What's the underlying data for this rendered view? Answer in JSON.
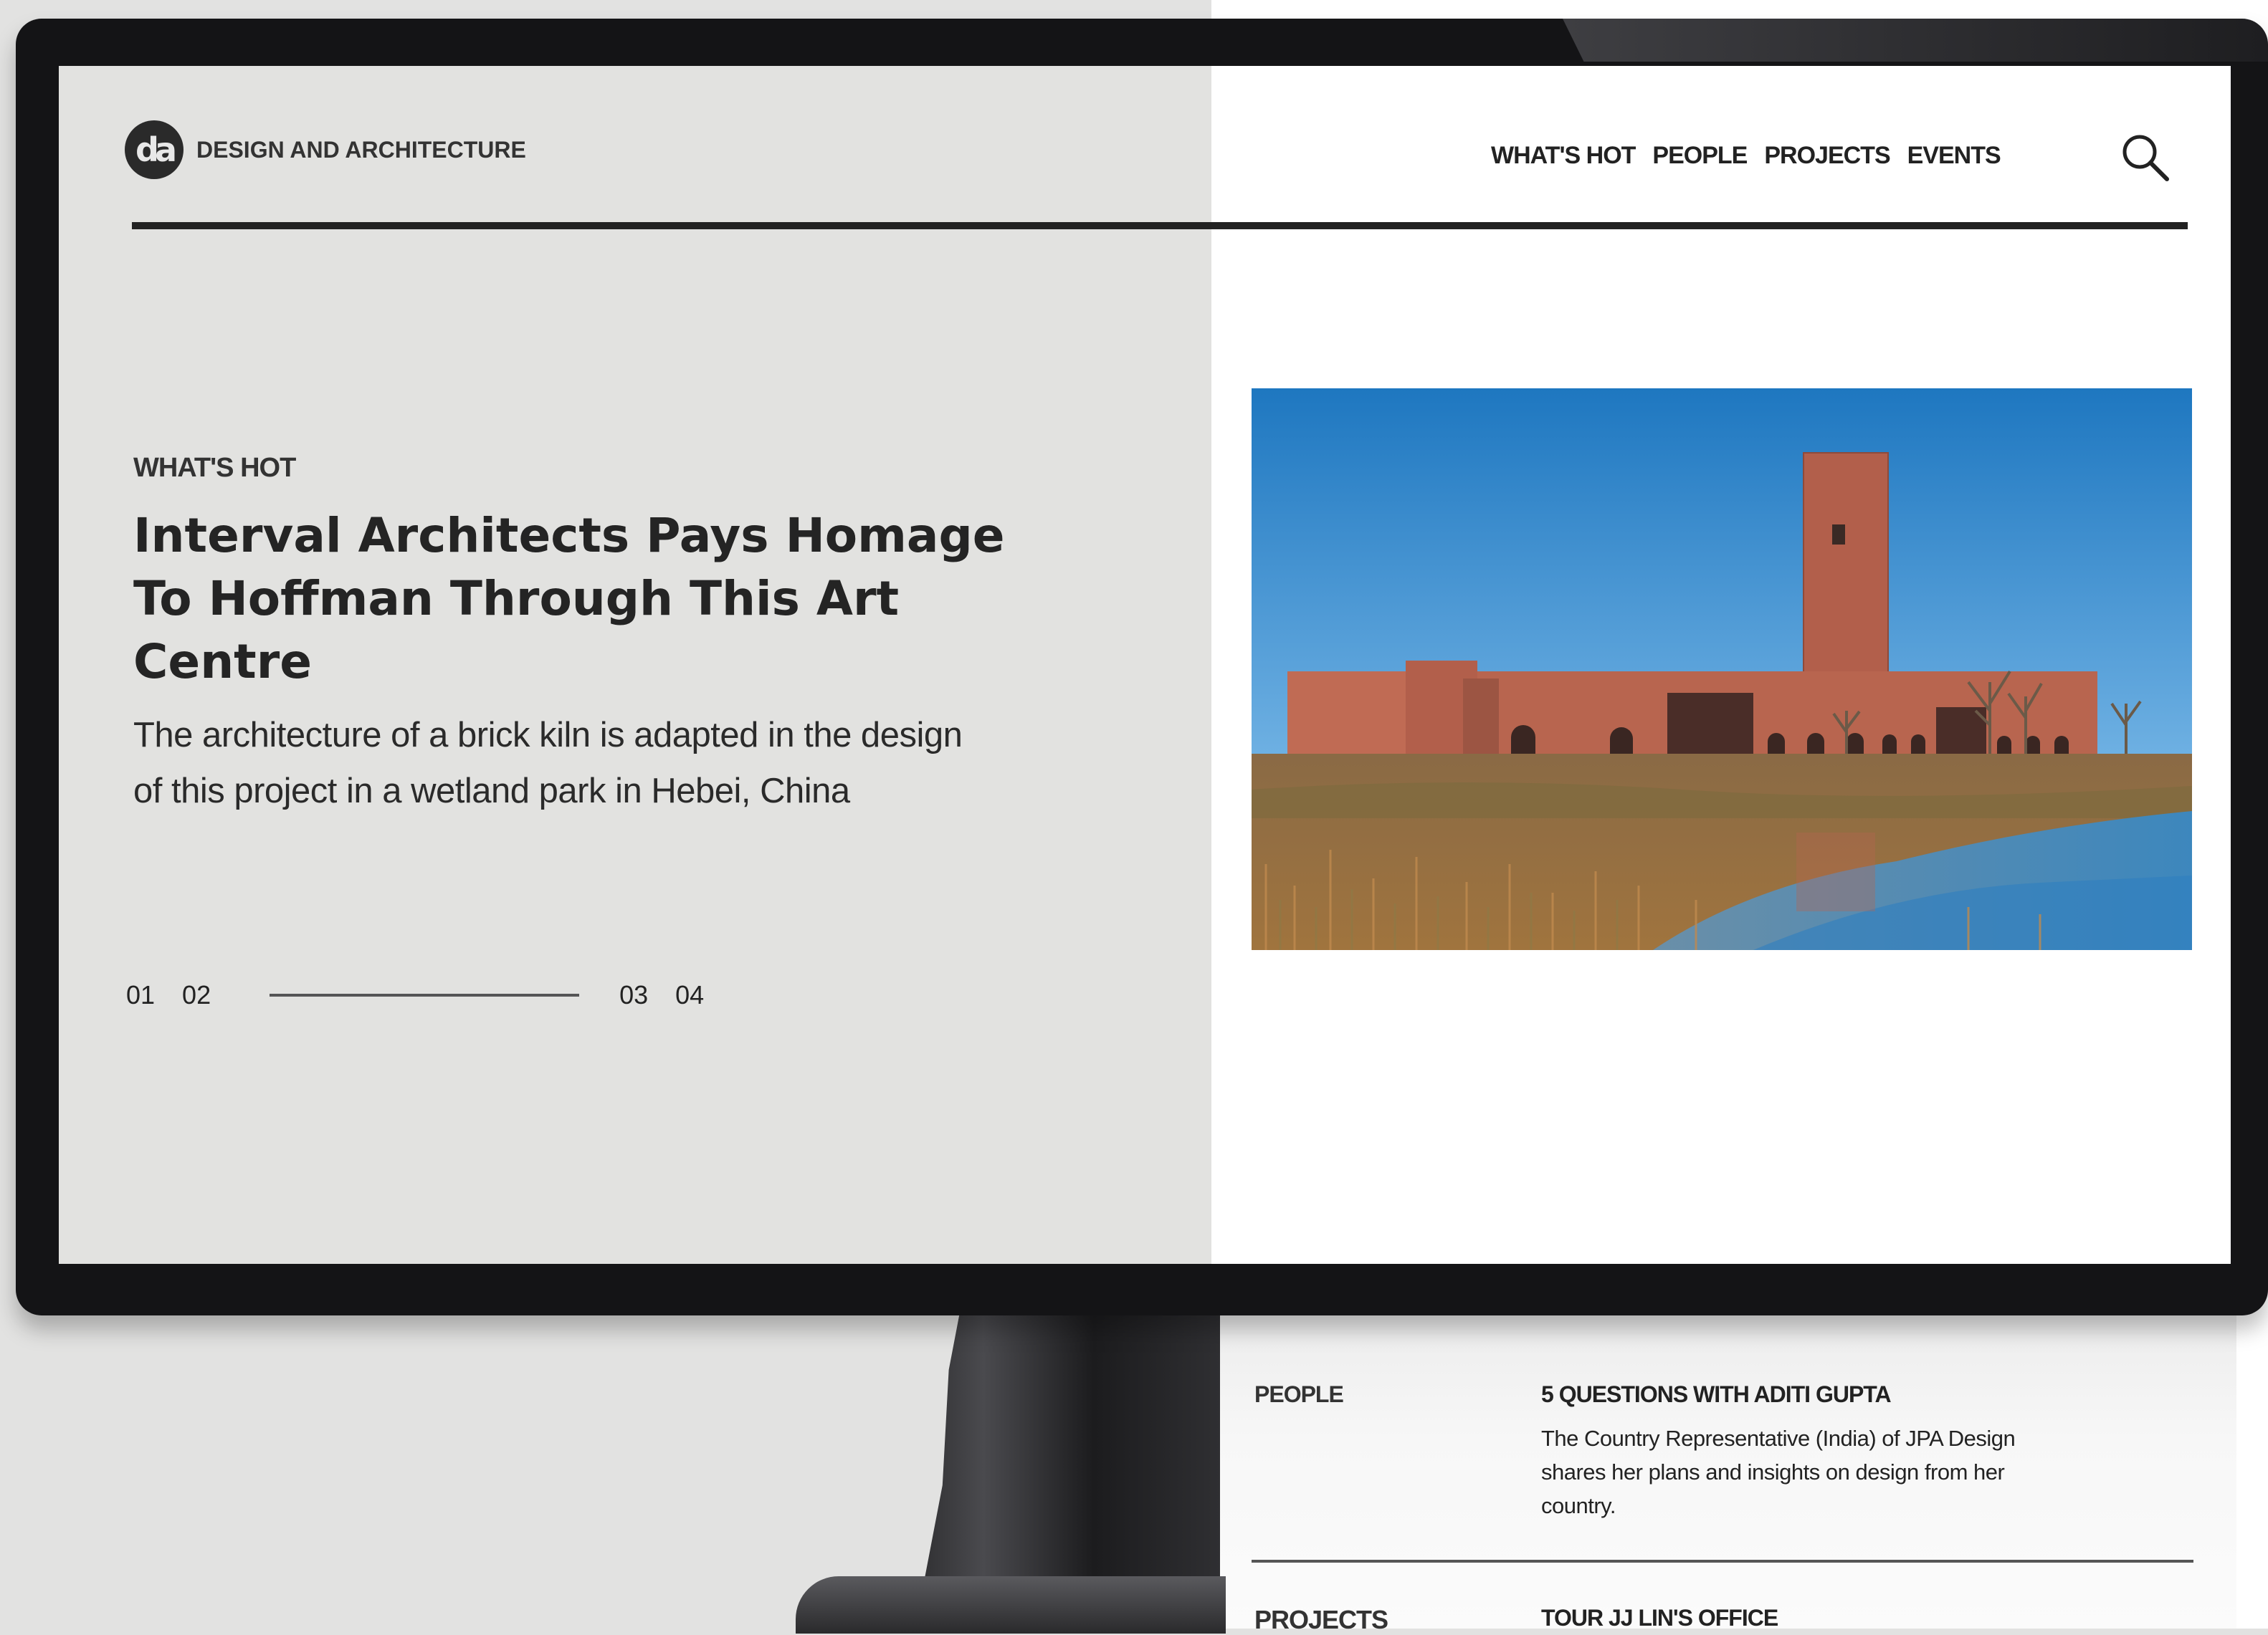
{
  "brand": {
    "logo_mark": "da",
    "name": "DESIGN AND ARCHITECTURE"
  },
  "nav": {
    "items": [
      "WHAT'S HOT",
      "PEOPLE",
      "PROJECTS",
      "EVENTS"
    ],
    "search_icon": "search-icon"
  },
  "hero": {
    "kicker": "WHAT'S HOT",
    "headline": "Interval Architects Pays Homage To Hoffman Through This Art Centre",
    "subhead": "The architecture of a brick kiln is adapted in the design of this project in a wetland park in Hebei, China",
    "image_subject": "brick art centre with tower beside wetland",
    "pager": [
      "01",
      "02",
      "03",
      "04"
    ]
  },
  "list": [
    {
      "category": "PEOPLE",
      "title": "5 QUESTIONS WITH ADITI GUPTA",
      "description": "The Country Representative (India) of JPA Design shares her plans and insights on design from her country."
    },
    {
      "category": "PROJECTS",
      "title": "TOUR JJ LIN'S OFFICE"
    }
  ],
  "colors": {
    "panel_grey": "#e2e2e0",
    "text_dark": "#222222",
    "bezel": "#141416"
  }
}
